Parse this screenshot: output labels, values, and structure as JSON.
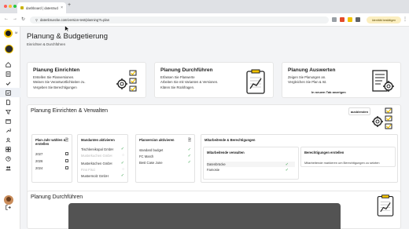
{
  "browser": {
    "tab_title": "dashboard | datestrucke",
    "url": "datenbruecke.com/version-test/planning?t=plan",
    "profile_label": "Identität bestätigen"
  },
  "sidebar": {
    "logo_text": "M",
    "items": [
      "home",
      "reports",
      "checklist",
      "documents",
      "filter",
      "calendar",
      "tools",
      "team",
      "dashboard",
      "help",
      "users"
    ]
  },
  "page": {
    "title": "Planung & Budgetierung",
    "breadcrumb": "Einrichten & Durchführen"
  },
  "overview": [
    {
      "title": "Planung Einrichten",
      "desc_1": "Erstellen Sie Planversionen.",
      "desc_2": "Weisen Sie Verantwortlichkeiten zu.",
      "desc_3": "Vergeben Sie Berechtigungen"
    },
    {
      "title": "Planung Durchführen",
      "desc_1": "Erfassen Sie Planwerte",
      "desc_2": "Arbeiten Sie mit Varianten & Versionen.",
      "desc_3": "Klären Sie Rückfragen."
    },
    {
      "title": "Planung Auswerten",
      "desc_1": "Zeigen Sie Planungen an.",
      "desc_2": "Vergleichen Sie Plan & Ist.",
      "link": "In neuem Tab anzeigen"
    }
  ],
  "setup": {
    "title": "Planung Einrichten & Verwalten",
    "collapse_label": "ausblenden",
    "plan_years": {
      "title_1": "Plan-Jahr wählen &",
      "title_2": "erstellen",
      "years": [
        "2027",
        "2026",
        "2024"
      ]
    },
    "clients": {
      "title": "Mandanten aktivieren",
      "rows": [
        {
          "label": "Tischlereikopal GmbH",
          "active": true
        },
        {
          "label": "Musterkuchen GmbH",
          "active": false
        },
        {
          "label": "Musterküchen GmbH",
          "active": true
        },
        {
          "label": "Fino Fisci",
          "active": false
        },
        {
          "label": "Mustermolz GmbH",
          "active": true
        }
      ]
    },
    "versions": {
      "title": "Planversion aktivieren",
      "rows": [
        {
          "label": "standard budget",
          "active": true
        },
        {
          "label": "FC March",
          "active": true
        },
        {
          "label": "Best Case June",
          "active": true
        }
      ]
    },
    "staff": {
      "title": "Mitarbeitende & Berechtigungen",
      "manage": {
        "title": "Mitarbeitende verwalten",
        "rows": [
          {
            "label": "Datenbrücke",
            "active": true
          },
          {
            "label": "Famosie",
            "active": true
          }
        ]
      },
      "permissions": {
        "title": "Berechtigungen erstellen",
        "text": "Mitarbeitende markieren um Berechtigungen zu setzten"
      }
    }
  },
  "execute": {
    "title": "Planung Durchführen"
  },
  "colors": {
    "accent": "#f2c300",
    "check": "#2f9e44",
    "sidebar_active": "#eef1f6"
  }
}
